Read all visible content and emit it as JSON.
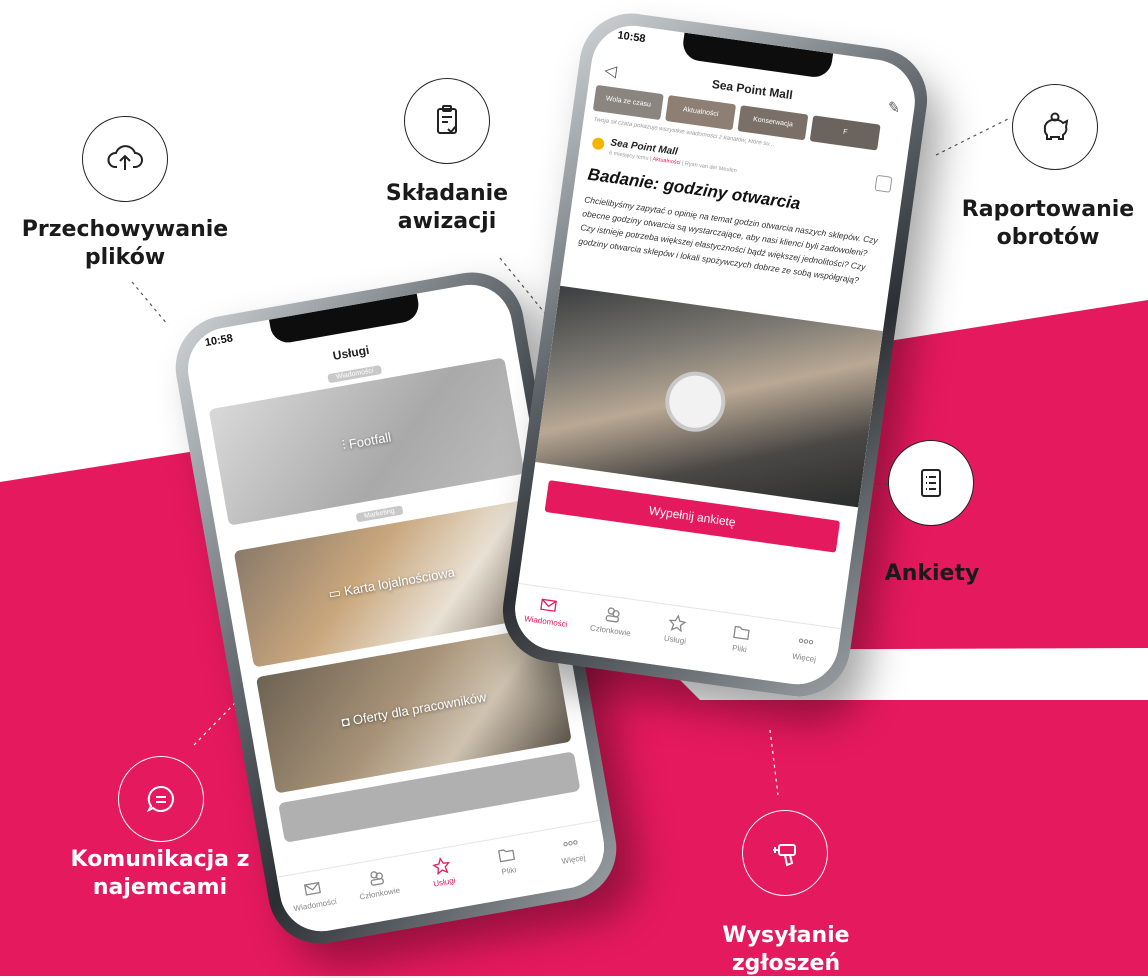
{
  "colors": {
    "brand_pink": "#e5195e",
    "text_dark": "#1a1a1a"
  },
  "features": {
    "storage": {
      "label": "Przechowywanie plików",
      "line1": "Przechowywanie",
      "line2": "plików",
      "icon": "cloud-upload-icon"
    },
    "notices": {
      "line1": "Składanie",
      "line2": "awizacji",
      "icon": "clipboard-check-icon"
    },
    "reporting": {
      "line1": "Raportowanie",
      "line2": "obrotów",
      "icon": "piggy-bank-icon"
    },
    "surveys": {
      "line1": "Ankiety",
      "icon": "list-icon"
    },
    "communication": {
      "line1": "Komunikacja z",
      "line2": "najemcami",
      "icon": "chat-bubble-icon"
    },
    "tickets": {
      "line1": "Wysyłanie",
      "line2": "zgłoszeń",
      "icon": "drill-icon"
    }
  },
  "left_phone": {
    "time": "10:58",
    "title": "Usługi",
    "section1": "Wiadomości",
    "card1": "Footfall",
    "section2": "Marketing",
    "card2": "Karta lojalnościowa",
    "card3": "Oferty dla pracowników",
    "tabs": [
      "Wiadomości",
      "Członkowie",
      "Usługi",
      "Pliki",
      "Więcej"
    ],
    "active_tab": "Usługi"
  },
  "right_phone": {
    "time": "10:58",
    "title": "Sea Point Mall",
    "chips": [
      "Wola ze czasu",
      "Aktualności",
      "Konserwacja",
      "F"
    ],
    "filter_hint": "Twoja sił czata pokazuje wszystkie wiadomości z kanałów, które su...",
    "post_author": "Sea Point Mall",
    "post_meta_prefix": "6 miesięcy temu |",
    "post_meta_channel": "Aktualności",
    "post_meta_suffix": "| Ryan van der Meulen",
    "post_title": "Badanie: godziny otwarcia",
    "post_body": "Chcielibyśmy zapytać o opinię na temat godzin otwarcia naszych sklepów. Czy obecne godziny otwarcia są wystarczające, aby nasi klienci byli zadowoleni? Czy istnieje potrzeba większej elastyczności bądź większej jednolitości? Czy godziny otwarcia sklepów i lokali spożywczych dobrze ze sobą współgrają?",
    "cta": "Wypełnij ankietę",
    "tabs": [
      "Wiadomości",
      "Członkowie",
      "Usługi",
      "Pliki",
      "Więcej"
    ],
    "active_tab": "Wiadomości"
  }
}
